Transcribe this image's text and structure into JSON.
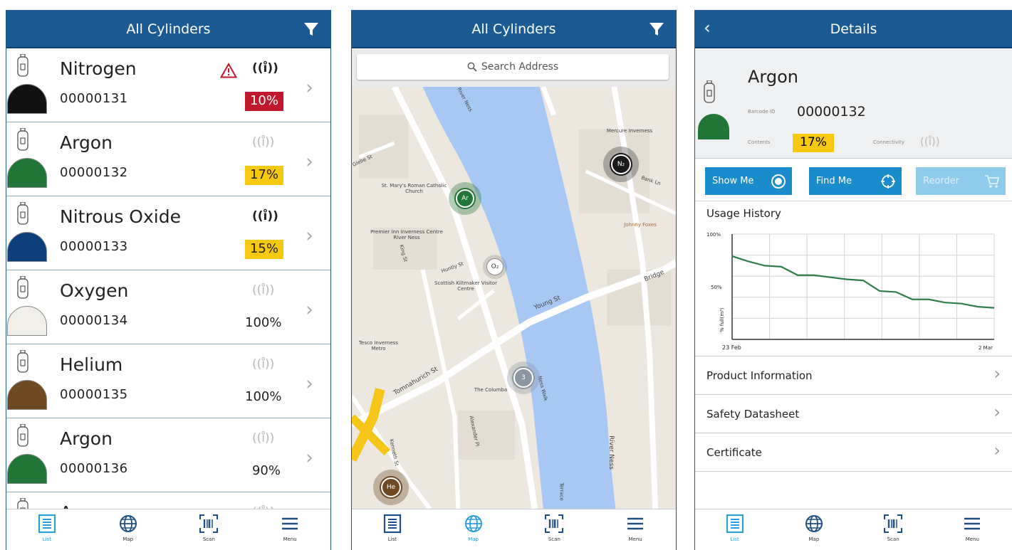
{
  "list_screen": {
    "title": "All Cylinders",
    "items": [
      {
        "name": "Nitrogen",
        "code": "00000131",
        "pct": "10%",
        "pct_style": "red",
        "connected": true,
        "warning": true,
        "color": "#111111"
      },
      {
        "name": "Argon",
        "code": "00000132",
        "pct": "17%",
        "pct_style": "yellow",
        "connected": false,
        "warning": false,
        "color": "#217637"
      },
      {
        "name": "Nitrous Oxide",
        "code": "00000133",
        "pct": "15%",
        "pct_style": "yellow",
        "connected": true,
        "warning": false,
        "color": "#0d3f7c"
      },
      {
        "name": "Oxygen",
        "code": "00000134",
        "pct": "100%",
        "pct_style": "plain",
        "connected": false,
        "warning": false,
        "color": "#f0efe9"
      },
      {
        "name": "Helium",
        "code": "00000135",
        "pct": "100%",
        "pct_style": "plain",
        "connected": false,
        "warning": false,
        "color": "#6e4a22"
      },
      {
        "name": "Argon",
        "code": "00000136",
        "pct": "90%",
        "pct_style": "plain",
        "connected": false,
        "warning": false,
        "color": "#217637"
      },
      {
        "name": "Argon",
        "code": "",
        "pct": "",
        "pct_style": "plain",
        "connected": false,
        "warning": false,
        "color": "#217637"
      }
    ],
    "signal_glyph": "((ı̊))"
  },
  "map_screen": {
    "title": "All Cylinders",
    "search_placeholder": "Search Address",
    "labels": {
      "river_top": "River Ness",
      "river_side": "River Ness",
      "mercure": "Mercure Inverness",
      "johnny": "Johnny Foxes",
      "st_marys": "St. Mary's Roman Catholic Church",
      "premier": "Premier Inn Inverness Centre River Ness",
      "huntly": "Huntly St",
      "scottish": "Scottish Kiltmaker Visitor Centre",
      "young": "Young St",
      "tesco": "Tesco Inverness Metro",
      "tomnahurich": "Tomnahurich St",
      "columba": "The Columba",
      "alexander": "Alexander Pl",
      "ness_walk": "Ness Walk",
      "terrace": "Terrace",
      "bank_ln": "Bank Ln",
      "bridge": "Bridge",
      "king_st": "King St",
      "kenneth": "Kenneth St",
      "glebe": "Glebe St"
    },
    "markers": [
      {
        "label": "Ar",
        "color": "#217637"
      },
      {
        "label": "N₂",
        "color": "#1a1a1a"
      },
      {
        "label": "O₂",
        "color": "#ffffff"
      },
      {
        "label": "3",
        "color": "#8c96a0"
      },
      {
        "label": "He",
        "color": "#6e4a22"
      }
    ]
  },
  "details_screen": {
    "title": "Details",
    "name": "Argon",
    "barcode_label": "Barcode ID",
    "barcode_value": "00000132",
    "contents_label": "Contents",
    "contents_value": "17%",
    "connectivity_label": "Connectivity",
    "show_me": "Show Me",
    "find_me": "Find Me",
    "reorder": "Reorder",
    "usage_title": "Usage History",
    "rows": [
      "Product Information",
      "Safety Datasheet",
      "Certificate"
    ]
  },
  "chart_data": {
    "type": "line",
    "ylabel": "% full(m³)",
    "ylim": [
      0,
      100
    ],
    "yticks": [
      "100%",
      "50%"
    ],
    "x_start_label": "23 Feb",
    "x_end_label": "2 Mar",
    "values": [
      79,
      74,
      70,
      69,
      61,
      61,
      59,
      57,
      56,
      46,
      45,
      38,
      38,
      35,
      34,
      31,
      30
    ],
    "grid": true,
    "series": [
      {
        "values": [
          79,
          74,
          70,
          69,
          61,
          61,
          59,
          57,
          56,
          46,
          45,
          38,
          38,
          35,
          34,
          31,
          30
        ],
        "color": "#2e7d4a"
      }
    ]
  },
  "nav": {
    "items": [
      {
        "label": "List"
      },
      {
        "label": "Map"
      },
      {
        "label": "Scan"
      },
      {
        "label": "Menu"
      }
    ],
    "active_color": "#2a9fd8"
  }
}
